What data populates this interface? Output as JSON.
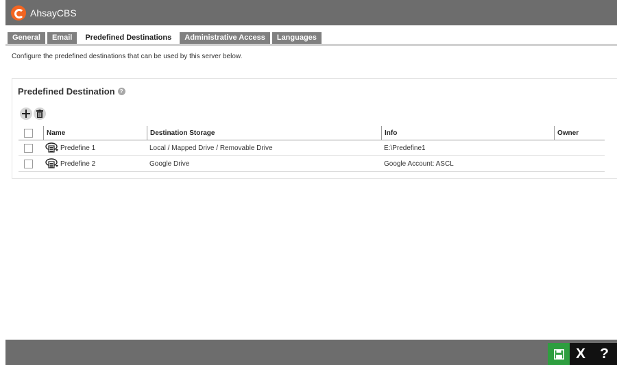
{
  "app": {
    "title": "AhsayCBS"
  },
  "tabs": [
    {
      "label": "General",
      "active": false
    },
    {
      "label": "Email",
      "active": false
    },
    {
      "label": "Predefined Destinations",
      "active": true
    },
    {
      "label": "Administrative Access",
      "active": false
    },
    {
      "label": "Languages",
      "active": false
    }
  ],
  "intro_text": "Configure the predefined destinations that can be used by this server below.",
  "panel": {
    "title": "Predefined Destination",
    "help_icon_text": "?",
    "toolbar_icons": [
      "add-icon",
      "trash-icon"
    ]
  },
  "table": {
    "columns": [
      "Name",
      "Destination Storage",
      "Info",
      "Owner"
    ],
    "rows": [
      {
        "name": "Predefine 1",
        "storage": "Local / Mapped Drive / Removable Drive",
        "info": "E:\\Predefine1",
        "owner": ""
      },
      {
        "name": "Predefine 2",
        "storage": "Google Drive",
        "info": "Google Account: ASCL",
        "owner": ""
      }
    ]
  },
  "footer": {
    "save_icon": "floppy-disk-icon",
    "close_label": "X",
    "help_label": "?"
  },
  "colors": {
    "title_bar": "#6d6d6d",
    "tab_inactive": "#808080",
    "logo": "#f26522",
    "save_button": "#2e9e3f",
    "footer_dark": "#111111"
  }
}
